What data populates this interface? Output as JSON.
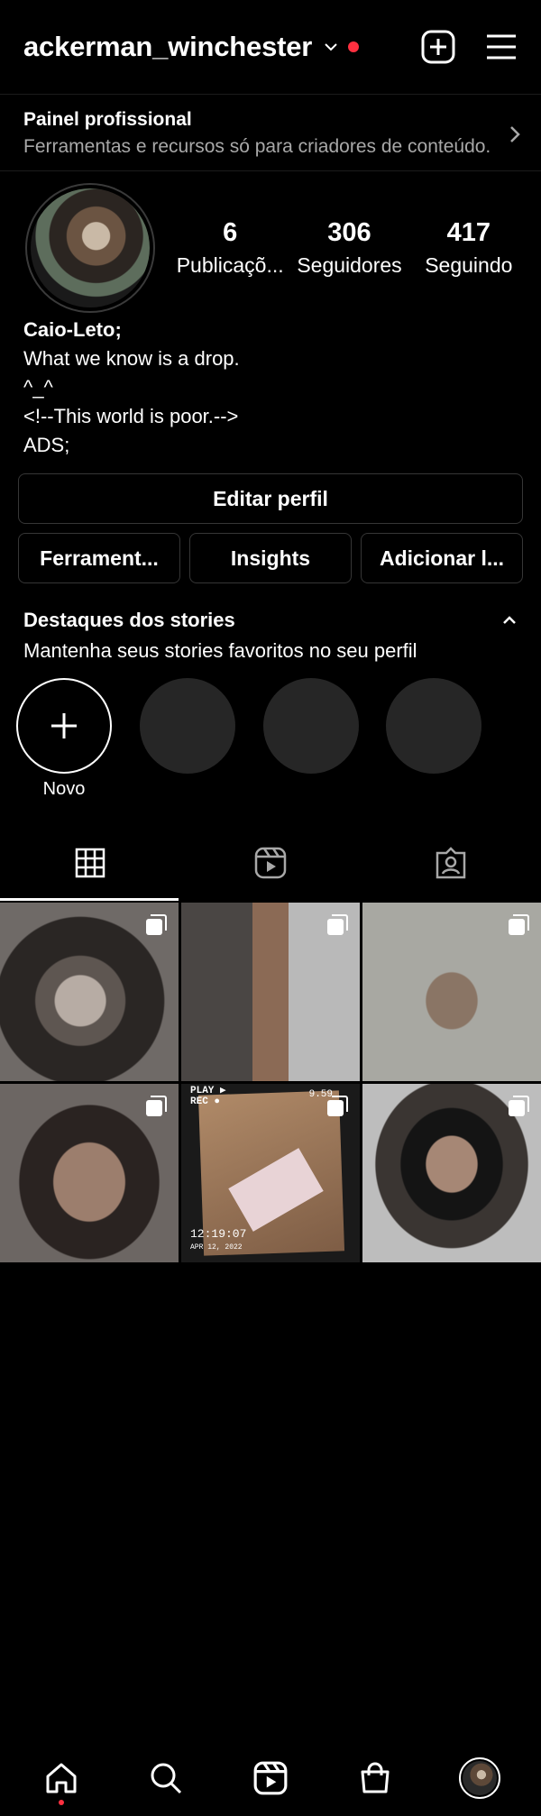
{
  "header": {
    "username": "ackerman_winchester",
    "icons": [
      "chevron-down-icon",
      "new-post-icon",
      "menu-icon"
    ],
    "notification_color": "#ff3040"
  },
  "dashboard": {
    "title": "Painel profissional",
    "subtitle": "Ferramentas e recursos só para criadores de conteúdo."
  },
  "profile": {
    "stats": [
      {
        "value": "6",
        "label": "Publicaçõ..."
      },
      {
        "value": "306",
        "label": "Seguidores"
      },
      {
        "value": "417",
        "label": "Seguindo"
      }
    ],
    "bio": {
      "name": "Caio-Leto;",
      "lines": [
        "What we know is a drop.",
        "^_^",
        "<!--This world is poor.-->",
        "ADS;"
      ]
    }
  },
  "buttons": {
    "edit_profile": "Editar perfil",
    "tools": "Ferrament...",
    "insights": "Insights",
    "add": "Adicionar l..."
  },
  "highlights": {
    "title": "Destaques dos stories",
    "subtitle": "Mantenha seus stories favoritos no seu perfil",
    "new_label": "Novo"
  },
  "tabs": [
    "grid-icon",
    "reels-icon",
    "tagged-icon"
  ],
  "posts": [
    {
      "type": "carousel",
      "label": ""
    },
    {
      "type": "carousel",
      "label": ""
    },
    {
      "type": "carousel",
      "label": ""
    },
    {
      "type": "carousel",
      "label": ""
    },
    {
      "type": "carousel",
      "overlay_top": "PLAY ▶",
      "overlay_rec": "REC ●",
      "overlay_time": "12:19:07",
      "overlay_date": "APR 12, 2022",
      "overlay_battery": "9.59"
    },
    {
      "type": "carousel",
      "label": ""
    }
  ],
  "bottom_nav": [
    "home-icon",
    "search-icon",
    "reels-icon",
    "shop-icon",
    "profile-avatar"
  ]
}
